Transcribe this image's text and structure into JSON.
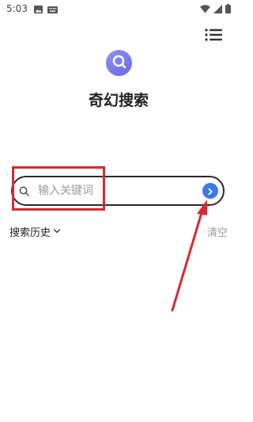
{
  "status_bar": {
    "time": "5:03",
    "icons": [
      "image-notification-icon",
      "keyboard-notification-icon",
      "wifi-icon",
      "signal-icon",
      "battery-icon"
    ]
  },
  "header": {
    "menu_icon": "menu-icon"
  },
  "app": {
    "logo_icon": "search-logo-icon",
    "title": "奇幻搜索"
  },
  "search": {
    "placeholder": "输入关键词",
    "value": "",
    "go_icon": "chevron-right-icon"
  },
  "history": {
    "label": "搜索历史",
    "toggle_icon": "chevron-down-icon",
    "clear_label": "清空"
  },
  "colors": {
    "logo": "#7b7bee",
    "go_button": "#3b7be8",
    "annotation": "#d9282f",
    "search_border": "#2a2a2a"
  }
}
